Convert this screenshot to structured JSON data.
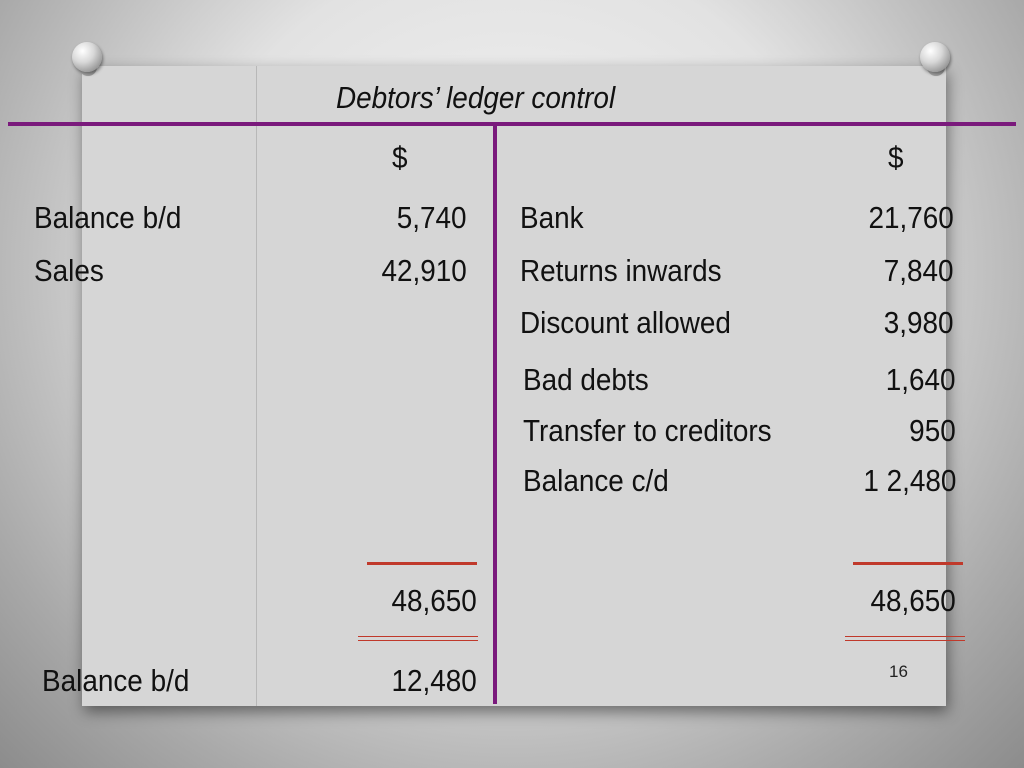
{
  "title": "Debtors’ ledger control",
  "currency_left": "$",
  "currency_right": "$",
  "debit": [
    {
      "label": "Balance b/d",
      "amount": "5,740"
    },
    {
      "label": "Sales",
      "amount": "42,910"
    }
  ],
  "credit": [
    {
      "label": "Bank",
      "amount": "21,760"
    },
    {
      "label": "Returns inwards",
      "amount": "7,840"
    },
    {
      "label": "Discount allowed",
      "amount": "3,980"
    },
    {
      "label": "Bad debts",
      "amount": "1,640"
    },
    {
      "label": "Transfer to creditors",
      "amount": "950"
    },
    {
      "label": "Balance  c/d",
      "amount": "1 2,480"
    }
  ],
  "totals": {
    "debit": "48,650",
    "credit": "48,650"
  },
  "closing": {
    "label": "Balance  b/d",
    "amount": "12,480"
  },
  "page_number": "16",
  "colors": {
    "rule": "#7a1a7c",
    "underline": "#c0392b"
  }
}
